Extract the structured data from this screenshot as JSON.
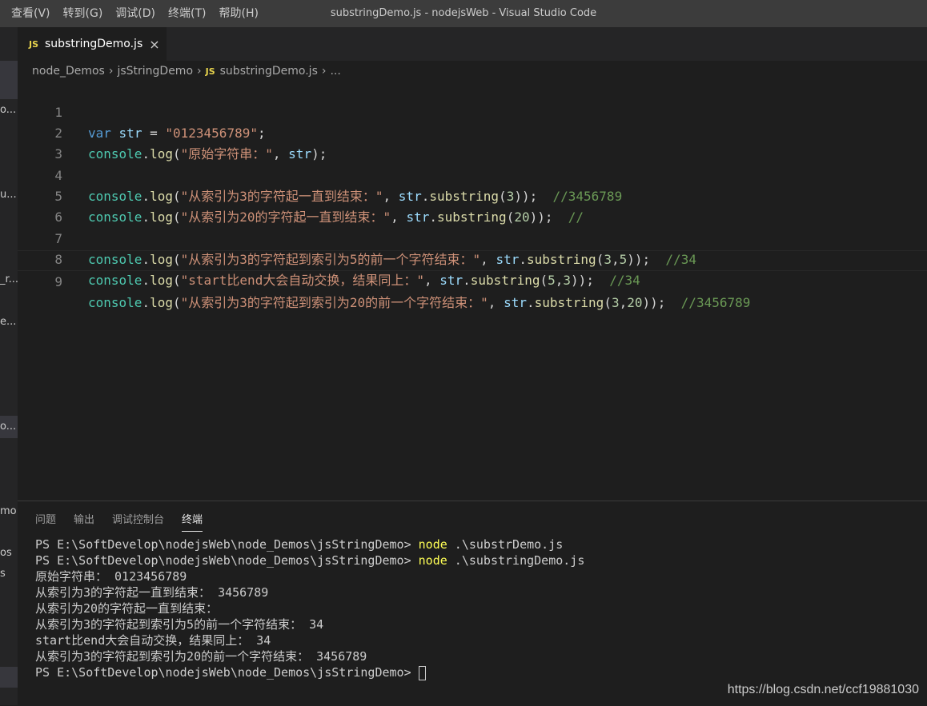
{
  "window": {
    "title": "substringDemo.js - nodejsWeb - Visual Studio Code"
  },
  "menu": [
    "查看(V)",
    "转到(G)",
    "调试(D)",
    "终端(T)",
    "帮助(H)"
  ],
  "sidebar": {
    "fragments": [
      "o...",
      "u...",
      "_r...",
      "e...",
      "o...",
      "mo",
      "os",
      "s"
    ]
  },
  "tab": {
    "icon": "JS",
    "label": "substringDemo.js",
    "close": "×"
  },
  "breadcrumb": {
    "items": [
      "node_Demos",
      "jsStringDemo",
      "substringDemo.js",
      "..."
    ],
    "file_icon": "JS"
  },
  "editor": {
    "line_numbers": [
      "1",
      "2",
      "3",
      "4",
      "5",
      "6",
      "7",
      "8",
      "9"
    ]
  },
  "panel": {
    "tabs": [
      "问题",
      "输出",
      "调试控制台",
      "终端"
    ],
    "active_tab": "终端",
    "terminal": {
      "prompt": "PS E:\\SoftDevelop\\nodejsWeb\\node_Demos\\jsStringDemo> ",
      "cmd": "node",
      "arg1": " .\\substrDemo.js",
      "arg2": " .\\substringDemo.js",
      "output": [
        "原始字符串： 0123456789",
        "从索引为3的字符起一直到结束： 3456789",
        "从索引为20的字符起一直到结束：",
        "从索引为3的字符起到索引为5的前一个字符结束： 34",
        "start比end大会自动交换，结果同上： 34",
        "从索引为3的字符起到索引为20的前一个字符结束： 3456789"
      ]
    }
  },
  "watermark": "https://blog.csdn.net/ccf19881030"
}
